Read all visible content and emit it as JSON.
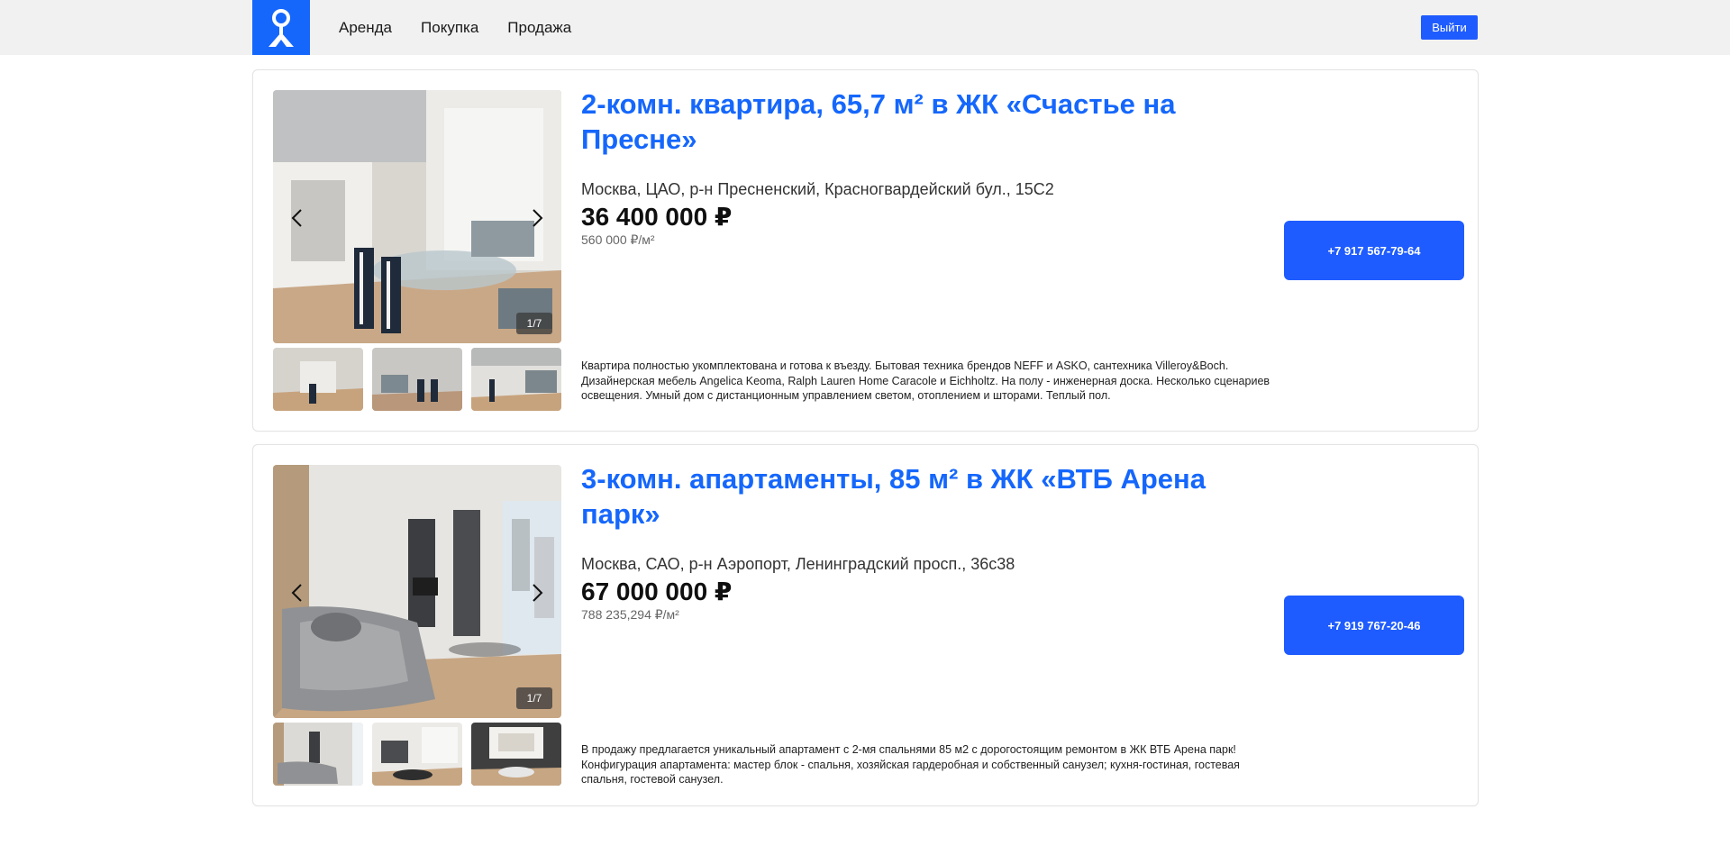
{
  "header": {
    "logo_icon": "map-pin-logo-icon",
    "nav": [
      "Аренда",
      "Покупка",
      "Продажа"
    ],
    "logout_label": "Выйти",
    "accent": "#1567fc"
  },
  "listings": [
    {
      "title": "2-комн. квартира, 65,7 м² в ЖК «Счастье на Пресне»",
      "address": "Москва, ЦАО, р-н Пресненский, Красногвардейский бул., 15С2",
      "price": "36 400 000 ₽",
      "price_per_m2": "560 000 ₽/м²",
      "photo_counter": "1/7",
      "description": "Квартира полностью укомплектована и готова к въезду. Бытовая техника брендов NEFF и ASKO, сантехника Villeroy&Boch. Дизайнерская мебель Angelica Keoma, Ralph Lauren Home Caracole и Eichholtz. На полу - инженерная доска. Несколько сценариев освещения. Умный дом с дистанционным управлением светом, отоплением и шторами. Теплый пол.",
      "phone": "+7 917 567-79-64"
    },
    {
      "title": "3-комн. апартаменты, 85 м² в ЖК «ВТБ Арена парк»",
      "address": "Москва, САО, р-н Аэропорт, Ленинградский просп., 36с38",
      "price": "67 000 000 ₽",
      "price_per_m2": "788 235,294 ₽/м²",
      "photo_counter": "1/7",
      "description": "В продажу предлагается уникальный апартамент с 2-мя спальнями 85 м2 с дорогостоящим ремонтом в ЖК ВТБ Арена парк! Конфигурация апартамента: мастер блок - спальня, хозяйская гардеробная и собственный санузел; кухня-гостиная, гостевая спальня, гостевой санузел.",
      "phone": "+7 919 767-20-46"
    }
  ]
}
